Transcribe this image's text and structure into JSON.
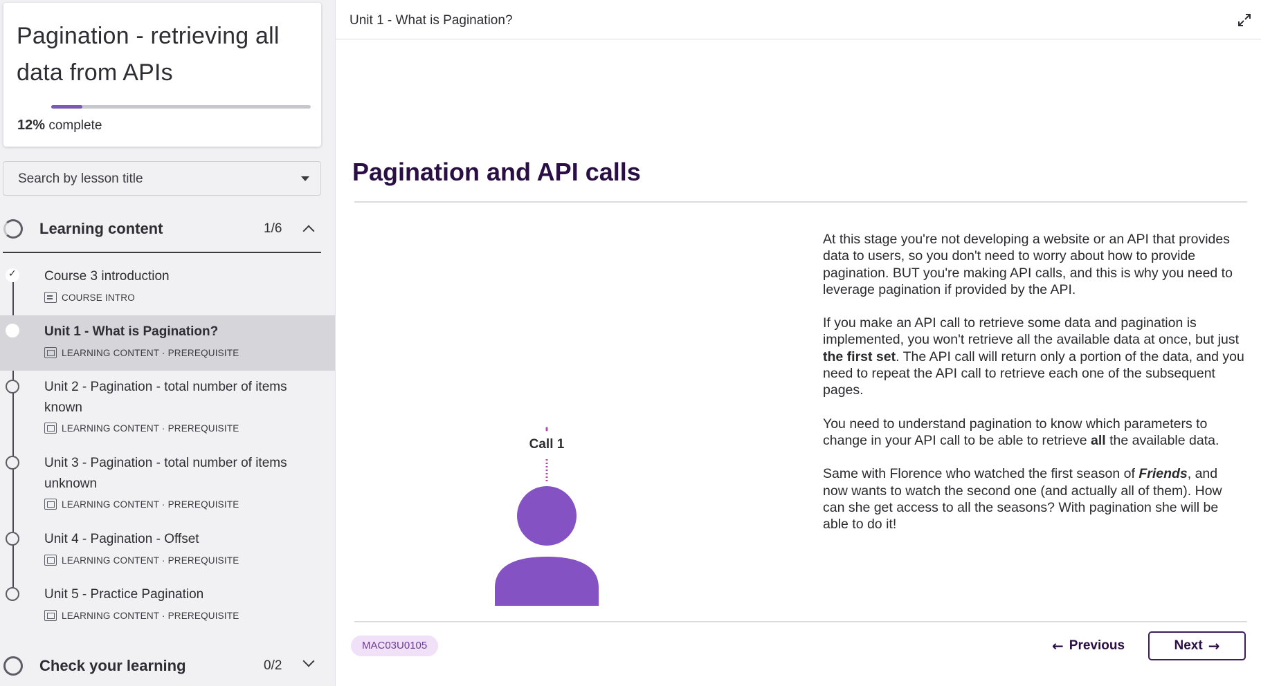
{
  "course": {
    "title": "Pagination - retrieving all data from APIs",
    "progress_percent": "12%",
    "progress_value": 0.12,
    "progress_suffix": "complete"
  },
  "search": {
    "placeholder": "Search by lesson title"
  },
  "sections": [
    {
      "title": "Learning content",
      "count": "1/6",
      "expanded": true
    },
    {
      "title": "Check your learning",
      "count": "0/2",
      "expanded": false
    }
  ],
  "lessons": [
    {
      "title": "Course 3 introduction",
      "meta": "COURSE INTRO",
      "status": "done",
      "icon": "document-icon"
    },
    {
      "title": "Unit 1 - What is Pagination?",
      "meta": "LEARNING CONTENT · PREREQUISITE",
      "status": "current",
      "icon": "screen-icon"
    },
    {
      "title": "Unit 2 - Pagination - total number of items known",
      "meta": "LEARNING CONTENT · PREREQUISITE",
      "status": "todo",
      "icon": "screen-icon"
    },
    {
      "title": "Unit 3 - Pagination - total number of items unknown",
      "meta": "LEARNING CONTENT · PREREQUISITE",
      "status": "todo",
      "icon": "screen-icon"
    },
    {
      "title": "Unit 4 - Pagination - Offset",
      "meta": "LEARNING CONTENT · PREREQUISITE",
      "status": "todo",
      "icon": "screen-icon"
    },
    {
      "title": "Unit 5 - Practice Pagination",
      "meta": "LEARNING CONTENT · PREREQUISITE",
      "status": "todo",
      "icon": "screen-icon"
    }
  ],
  "main": {
    "unit_title": "Unit 1 - What is Pagination?",
    "slide_title": "Pagination and API calls",
    "illustration_label": "Call 1",
    "paragraphs": {
      "p1": "At this stage you're not developing a website or an API that provides data to users, so you don't need to worry about how to provide pagination. BUT you're making API calls, and this is why you need to leverage pagination if provided by the API.",
      "p2a": "If you make an API call to retrieve some data and pagination is implemented, you won't retrieve all the available data at once, but just ",
      "p2b": "the first set",
      "p2c": ". The API call will return only a portion of the data, and you need to repeat the API call to retrieve each one of the subsequent pages.",
      "p3a": "You need to understand pagination to know which parameters to change in your API call to be able to retrieve ",
      "p3b": "all",
      "p3c": " the available data.",
      "p4a": "Same with Florence who watched the first season of ",
      "p4b": "Friends",
      "p4c": ", and now wants to watch the second one (and actually all of them). How can she get access to all the seasons? With pagination she will be able to do it!"
    },
    "code": "MAC03U0105",
    "prev_label": "Previous",
    "next_label": "Next"
  },
  "colors": {
    "accent": "#7a5ab5",
    "title": "#2a0f45",
    "person": "#8452c3",
    "badge_bg": "#f0e0f8"
  }
}
